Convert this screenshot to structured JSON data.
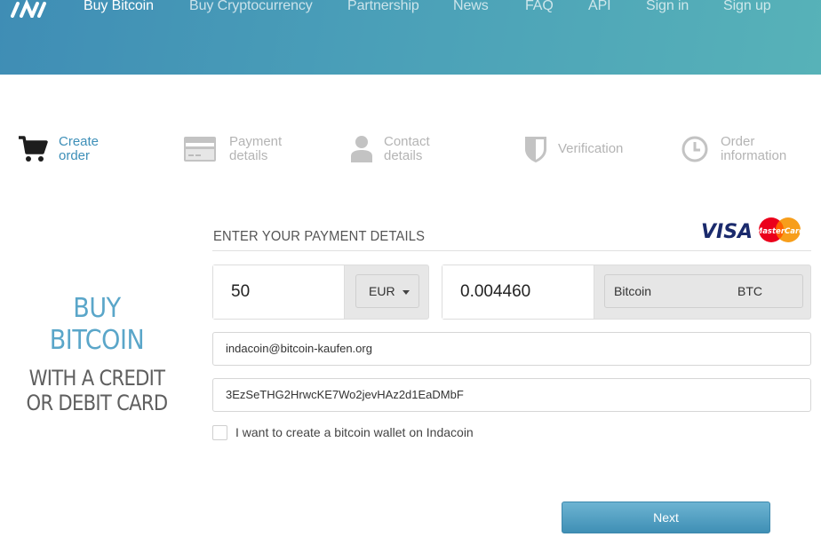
{
  "nav": {
    "items": [
      {
        "label": "Buy Bitcoin",
        "active": true
      },
      {
        "label": "Buy Cryptocurrency"
      },
      {
        "label": "Partnership"
      },
      {
        "label": "News"
      },
      {
        "label": "FAQ"
      },
      {
        "label": "API"
      },
      {
        "label": "Sign in"
      },
      {
        "label": "Sign up"
      }
    ]
  },
  "steps": [
    {
      "line1": "Create",
      "line2": "order",
      "icon": "cart-icon",
      "active": true
    },
    {
      "line1": "Payment",
      "line2": "details",
      "icon": "credit-card-icon"
    },
    {
      "line1": "Contact",
      "line2": "details",
      "icon": "user-icon"
    },
    {
      "line1": "Verification",
      "line2": "",
      "icon": "shield-icon"
    },
    {
      "line1": "Order",
      "line2": "information",
      "icon": "clock-icon"
    }
  ],
  "promo": {
    "line1": "BUY",
    "line2": "BITCOIN",
    "line3": "WITH A CREDIT",
    "line4": "OR DEBIT CARD"
  },
  "form": {
    "title": "ENTER YOUR PAYMENT DETAILS",
    "amount": "50",
    "currency": "EUR",
    "crypto_amount": "0.004460",
    "crypto_name": "Bitcoin",
    "crypto_code": "BTC",
    "email": "indacoin@bitcoin-kaufen.org",
    "wallet": "3EzSeTHG2HrwcKE7Wo2jevHAz2d1EaDMbF",
    "wallet_checkbox_label": "I want to create a bitcoin wallet on Indacoin",
    "next_label": "Next"
  },
  "cards": {
    "visa": "VISA",
    "mastercard": "MasterCard"
  },
  "colors": {
    "accent": "#3d8fb8",
    "header_start": "#3f8db5",
    "header_end": "#57b2b8",
    "inactive": "#b4b4b4"
  }
}
